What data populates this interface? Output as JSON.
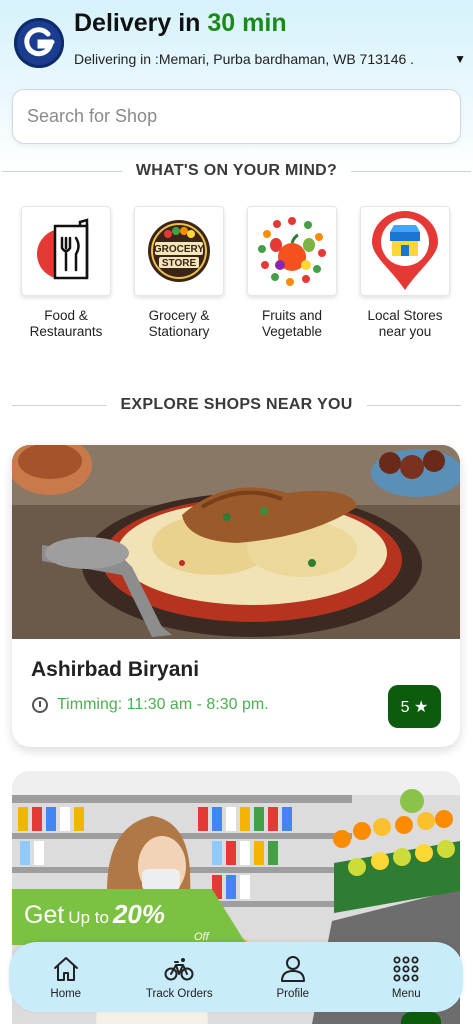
{
  "header": {
    "title_prefix": "Delivery in ",
    "title_accent": "30 min",
    "address": "Delivering in :Memari, Purba bardhaman, WB 713146 .",
    "caret": "▼"
  },
  "search": {
    "placeholder": "Search for Shop"
  },
  "categories_section": {
    "title": "WHAT'S ON YOUR MIND?",
    "items": [
      {
        "label_line1": "Food &",
        "label_line2": "Restaurants",
        "icon": "food-restaurant-icon"
      },
      {
        "label_line1": "Grocery &",
        "label_line2": "Stationary",
        "icon": "grocery-store-icon",
        "badge_text_1": "GROCERY",
        "badge_text_2": "STORE"
      },
      {
        "label_line1": "Fruits and",
        "label_line2": "Vegetable",
        "icon": "fruits-vegetables-icon"
      },
      {
        "label_line1": "Local Stores",
        "label_line2": "near you",
        "icon": "local-store-pin-icon"
      }
    ]
  },
  "shops_section": {
    "title": "EXPLORE SHOPS NEAR YOU",
    "shops": [
      {
        "name": "Ashirbad Biryani",
        "timing": "Timming: 11:30 am - 8:30 pm.",
        "rating": "5 ★"
      }
    ],
    "promo": {
      "get": "Get",
      "upto": "Up to",
      "percent": "20%",
      "off": "Off"
    }
  },
  "bottom_nav": {
    "items": [
      {
        "label": "Home",
        "icon": "home-icon"
      },
      {
        "label": "Track Orders",
        "icon": "bicycle-icon"
      },
      {
        "label": "Profile",
        "icon": "person-icon"
      },
      {
        "label": "Menu",
        "icon": "grid-menu-icon"
      }
    ]
  },
  "colors": {
    "accent_green": "#1a8a1a",
    "rating_green": "#0d5c0d",
    "timing_green": "#4caf50",
    "nav_bg": "#c8ecfa",
    "header_bg": "#d6f2fb",
    "logo_blue": "#1a3d8f"
  }
}
